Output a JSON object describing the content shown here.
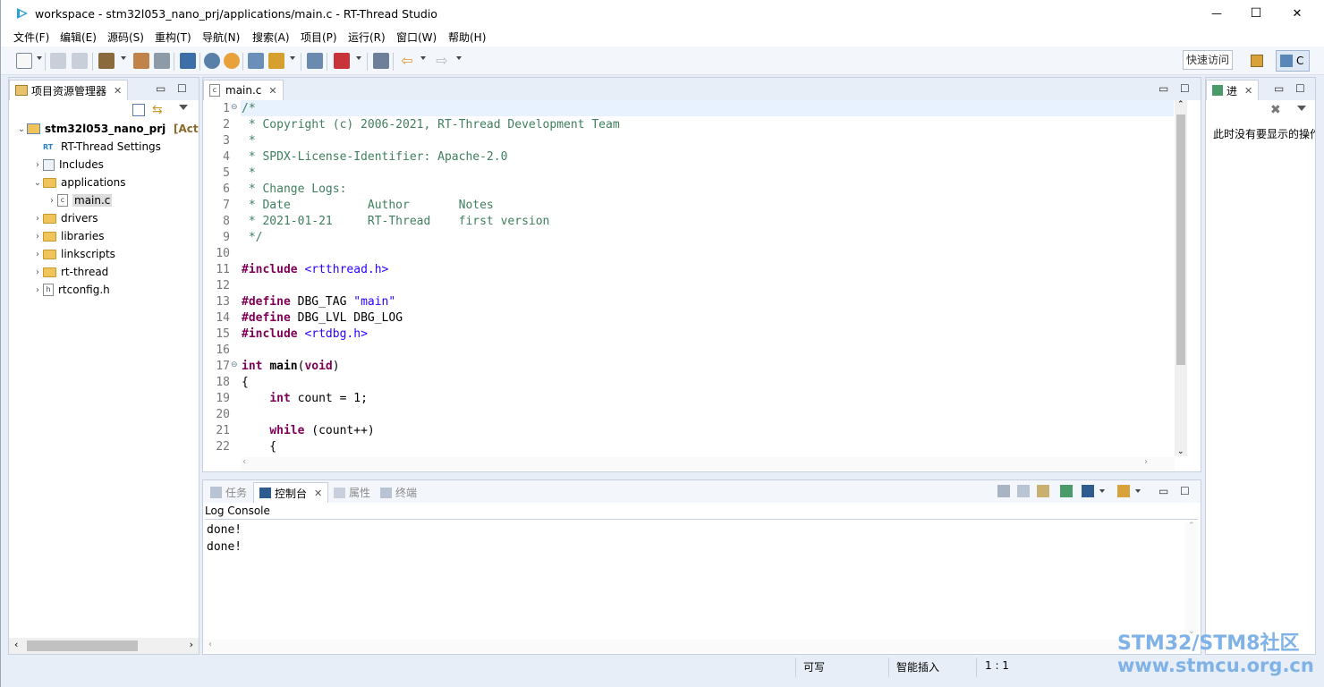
{
  "window": {
    "title": "workspace - stm32l053_nano_prj/applications/main.c - RT-Thread Studio",
    "controls": {
      "minimize": "—",
      "maximize": "☐",
      "close": "✕"
    }
  },
  "menu": [
    "文件(F)",
    "编辑(E)",
    "源码(S)",
    "重构(T)",
    "导航(N)",
    "搜索(A)",
    "项目(P)",
    "运行(R)",
    "窗口(W)",
    "帮助(H)"
  ],
  "toolbar": {
    "quick_access": "快速访问",
    "perspective_label": "C"
  },
  "explorer": {
    "tab_label": "项目资源管理器",
    "project": "stm32l053_nano_prj",
    "project_suffix": "[Act",
    "items": [
      {
        "label": "RT-Thread Settings",
        "kind": "settings",
        "expandable": false,
        "expanded": false
      },
      {
        "label": "Includes",
        "kind": "includes",
        "expandable": true,
        "expanded": false
      },
      {
        "label": "applications",
        "kind": "folder",
        "expandable": true,
        "expanded": true
      },
      {
        "label": "main.c",
        "kind": "c-file",
        "expandable": true,
        "expanded": false,
        "selected": true,
        "child": true
      },
      {
        "label": "drivers",
        "kind": "folder",
        "expandable": true,
        "expanded": false
      },
      {
        "label": "libraries",
        "kind": "folder",
        "expandable": true,
        "expanded": false
      },
      {
        "label": "linkscripts",
        "kind": "folder",
        "expandable": true,
        "expanded": false
      },
      {
        "label": "rt-thread",
        "kind": "folder",
        "expandable": true,
        "expanded": false
      },
      {
        "label": "rtconfig.h",
        "kind": "h-file",
        "expandable": true,
        "expanded": false
      }
    ]
  },
  "editor": {
    "tab_label": "main.c",
    "lines": [
      [
        {
          "t": "/*",
          "c": "cm"
        }
      ],
      [
        {
          "t": " * Copyright (c) 2006-2021, RT-Thread Development Team",
          "c": "cm"
        }
      ],
      [
        {
          "t": " *",
          "c": "cm"
        }
      ],
      [
        {
          "t": " * SPDX-License-Identifier: Apache-2.0",
          "c": "cm"
        }
      ],
      [
        {
          "t": " *",
          "c": "cm"
        }
      ],
      [
        {
          "t": " * Change Logs:",
          "c": "cm"
        }
      ],
      [
        {
          "t": " * Date           Author       Notes",
          "c": "cm"
        }
      ],
      [
        {
          "t": " * 2021-01-21     RT-Thread    first version",
          "c": "cm"
        }
      ],
      [
        {
          "t": " */",
          "c": "cm"
        }
      ],
      [],
      [
        {
          "t": "#include",
          "c": "kw"
        },
        {
          "t": " "
        },
        {
          "t": "<rtthread.h>",
          "c": "inc"
        }
      ],
      [],
      [
        {
          "t": "#define",
          "c": "kw"
        },
        {
          "t": " DBG_TAG "
        },
        {
          "t": "\"main\"",
          "c": "st"
        }
      ],
      [
        {
          "t": "#define",
          "c": "kw"
        },
        {
          "t": " DBG_LVL DBG_LOG"
        }
      ],
      [
        {
          "t": "#include",
          "c": "kw"
        },
        {
          "t": " "
        },
        {
          "t": "<rtdbg.h>",
          "c": "inc"
        }
      ],
      [],
      [
        {
          "t": "int",
          "c": "kw"
        },
        {
          "t": " "
        },
        {
          "t": "main",
          "c": "fn"
        },
        {
          "t": "("
        },
        {
          "t": "void",
          "c": "kw"
        },
        {
          "t": ")"
        }
      ],
      [
        {
          "t": "{"
        }
      ],
      [
        {
          "t": "    "
        },
        {
          "t": "int",
          "c": "kw"
        },
        {
          "t": " count = 1;"
        }
      ],
      [],
      [
        {
          "t": "    "
        },
        {
          "t": "while",
          "c": "kw"
        },
        {
          "t": " (count++)"
        }
      ],
      [
        {
          "t": "    {"
        }
      ]
    ]
  },
  "bottom_panel": {
    "tabs": [
      {
        "label": "任务",
        "active": false
      },
      {
        "label": "控制台",
        "active": true
      },
      {
        "label": "属性",
        "active": false
      },
      {
        "label": "终端",
        "active": false
      }
    ],
    "console_title": "Log Console",
    "console_lines": [
      "done!",
      "done!"
    ]
  },
  "right_panel": {
    "tab_label": "进",
    "message": "此时没有要显示的操作"
  },
  "status": {
    "writable": "可写",
    "insert_mode": "智能插入",
    "position": "1 : 1"
  },
  "watermark": {
    "line1": "STM32/STM8社区",
    "line2": "www.stmcu.org.cn"
  }
}
